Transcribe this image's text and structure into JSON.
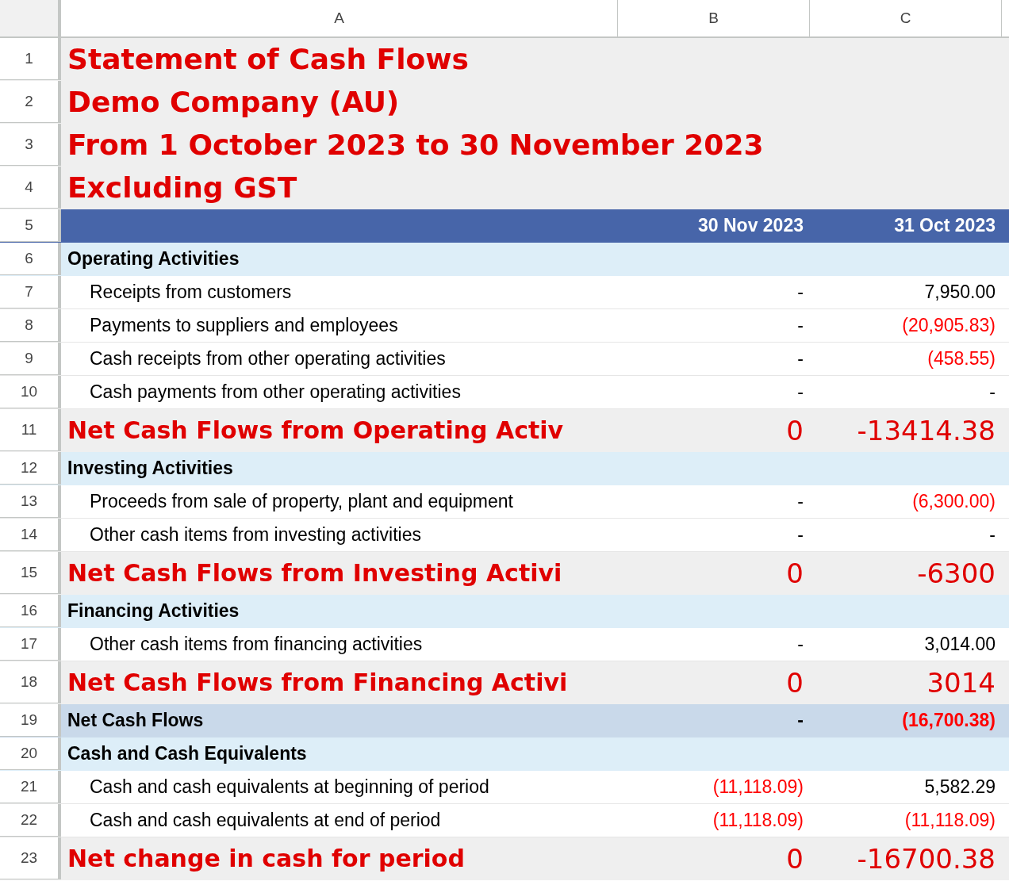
{
  "columns": [
    "A",
    "B",
    "C"
  ],
  "rows": [
    {
      "number": "1",
      "kind": "title",
      "a": "Statement of Cash Flows"
    },
    {
      "number": "2",
      "kind": "title",
      "a": "Demo Company (AU)"
    },
    {
      "number": "3",
      "kind": "title",
      "a": "From 1 October 2023 to 30 November 2023"
    },
    {
      "number": "4",
      "kind": "title",
      "a": "Excluding GST"
    },
    {
      "number": "5",
      "kind": "header",
      "b": {
        "text": "30 Nov 2023",
        "negative": false
      },
      "c": {
        "text": "31 Oct 2023",
        "negative": false
      }
    },
    {
      "number": "6",
      "kind": "section",
      "a": "Operating Activities"
    },
    {
      "number": "7",
      "kind": "line",
      "a": "Receipts from customers",
      "b": {
        "text": "-",
        "negative": false
      },
      "c": {
        "text": "7,950.00",
        "negative": false
      }
    },
    {
      "number": "8",
      "kind": "line",
      "a": "Payments to suppliers and employees",
      "b": {
        "text": "-",
        "negative": false
      },
      "c": {
        "text": "(20,905.83)",
        "negative": true
      }
    },
    {
      "number": "9",
      "kind": "line",
      "a": "Cash receipts from other operating activities",
      "b": {
        "text": "-",
        "negative": false
      },
      "c": {
        "text": "(458.55)",
        "negative": true
      }
    },
    {
      "number": "10",
      "kind": "line",
      "a": "Cash payments from other operating activities",
      "b": {
        "text": "-",
        "negative": false
      },
      "c": {
        "text": "-",
        "negative": false
      }
    },
    {
      "number": "11",
      "kind": "total",
      "a": "Net Cash Flows from Operating Activ",
      "b": {
        "text": "0"
      },
      "c": {
        "text": "-13414.38"
      }
    },
    {
      "number": "12",
      "kind": "section",
      "a": "Investing Activities"
    },
    {
      "number": "13",
      "kind": "line",
      "a": "Proceeds from sale of property, plant and equipment",
      "b": {
        "text": "-",
        "negative": false
      },
      "c": {
        "text": "(6,300.00)",
        "negative": true
      }
    },
    {
      "number": "14",
      "kind": "line",
      "a": "Other cash items from investing activities",
      "b": {
        "text": "-",
        "negative": false
      },
      "c": {
        "text": "-",
        "negative": false
      }
    },
    {
      "number": "15",
      "kind": "total",
      "a": "Net Cash Flows from Investing Activi",
      "b": {
        "text": "0"
      },
      "c": {
        "text": "-6300"
      }
    },
    {
      "number": "16",
      "kind": "section",
      "a": "Financing Activities"
    },
    {
      "number": "17",
      "kind": "line",
      "a": "Other cash items from financing activities",
      "b": {
        "text": "-",
        "negative": false
      },
      "c": {
        "text": "3,014.00",
        "negative": false
      }
    },
    {
      "number": "18",
      "kind": "total",
      "a": "Net Cash Flows from Financing Activi",
      "b": {
        "text": "0"
      },
      "c": {
        "text": "3014"
      }
    },
    {
      "number": "19",
      "kind": "netflow",
      "a": "Net Cash Flows",
      "b": {
        "text": "-",
        "negative": false
      },
      "c": {
        "text": "(16,700.38)",
        "negative": true
      }
    },
    {
      "number": "20",
      "kind": "section",
      "a": "Cash and Cash Equivalents"
    },
    {
      "number": "21",
      "kind": "line",
      "a": "Cash and cash equivalents at beginning of period",
      "b": {
        "text": "(11,118.09)",
        "negative": true
      },
      "c": {
        "text": "5,582.29",
        "negative": false
      }
    },
    {
      "number": "22",
      "kind": "line",
      "a": "Cash and cash equivalents at end of period",
      "b": {
        "text": "(11,118.09)",
        "negative": true
      },
      "c": {
        "text": "(11,118.09)",
        "negative": true
      }
    },
    {
      "number": "23",
      "kind": "total",
      "a": "Net change in cash for period",
      "b": {
        "text": "0"
      },
      "c": {
        "text": "-16700.38"
      }
    }
  ]
}
